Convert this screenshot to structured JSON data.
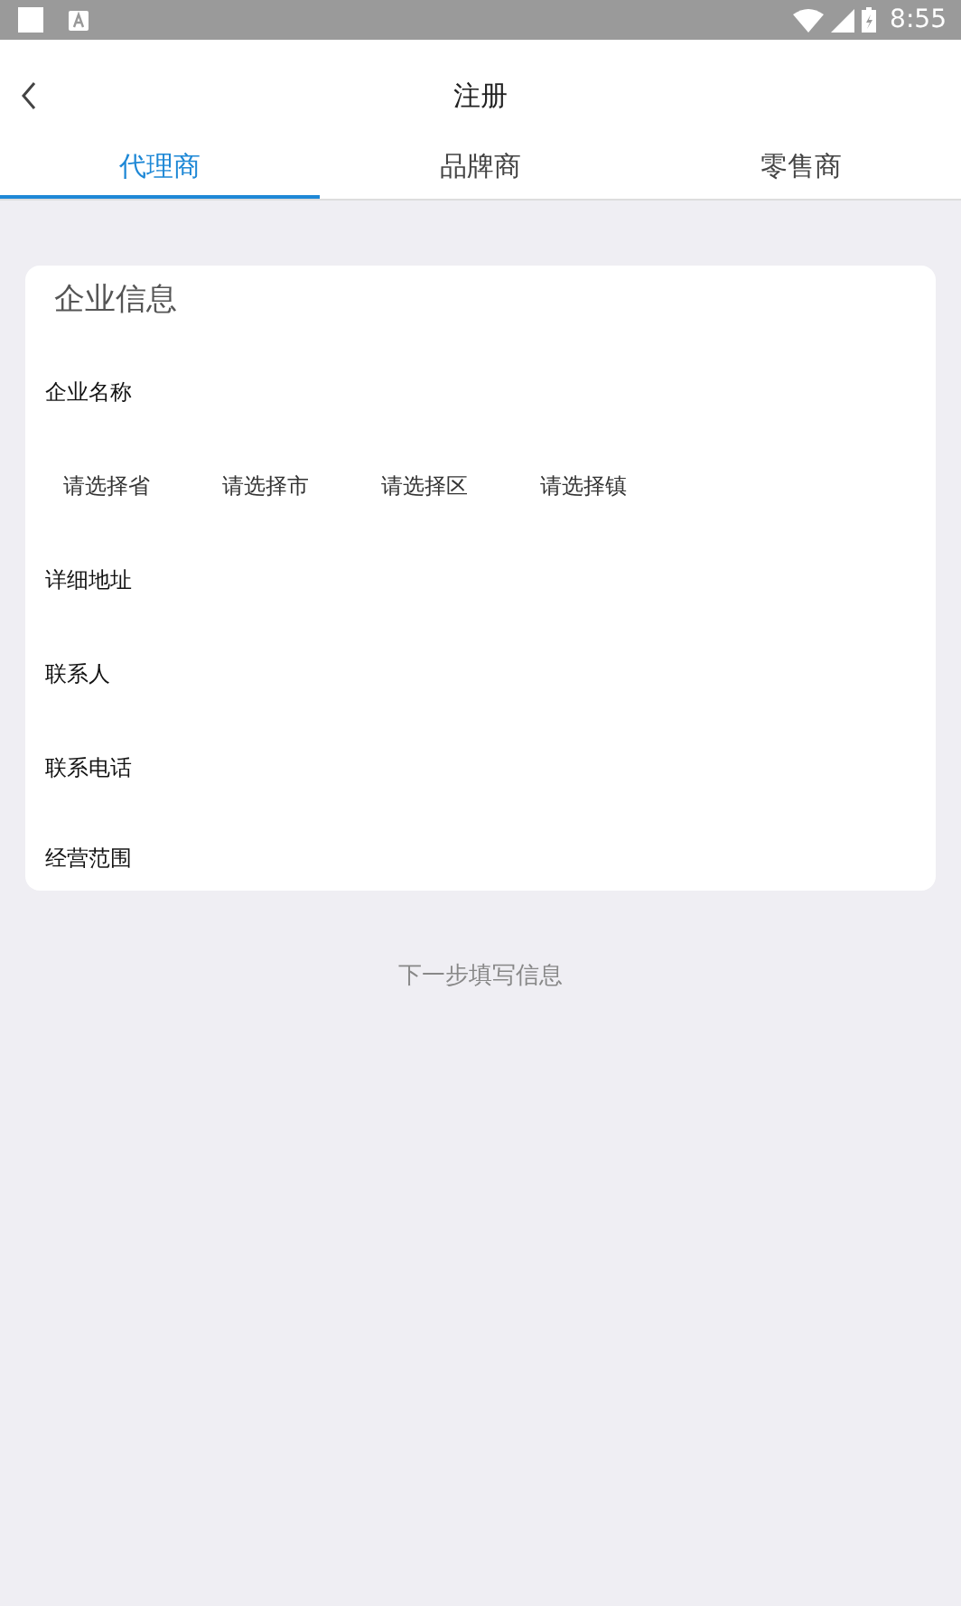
{
  "status_bar": {
    "time": "8:55"
  },
  "header": {
    "title": "注册"
  },
  "tabs": [
    {
      "label": "代理商",
      "selected": true
    },
    {
      "label": "品牌商",
      "selected": false
    },
    {
      "label": "零售商",
      "selected": false
    }
  ],
  "card": {
    "title": "企业信息",
    "rows": [
      {
        "kind": "field",
        "label": "企业名称"
      },
      {
        "kind": "picker",
        "options": [
          "请选择省",
          "请选择市",
          "请选择区",
          "请选择镇"
        ]
      },
      {
        "kind": "field",
        "label": "详细地址"
      },
      {
        "kind": "field",
        "label": "联系人"
      },
      {
        "kind": "field",
        "label": "联系电话"
      },
      {
        "kind": "field",
        "label": "经营范围"
      }
    ]
  },
  "next_button": "下一步填写信息"
}
